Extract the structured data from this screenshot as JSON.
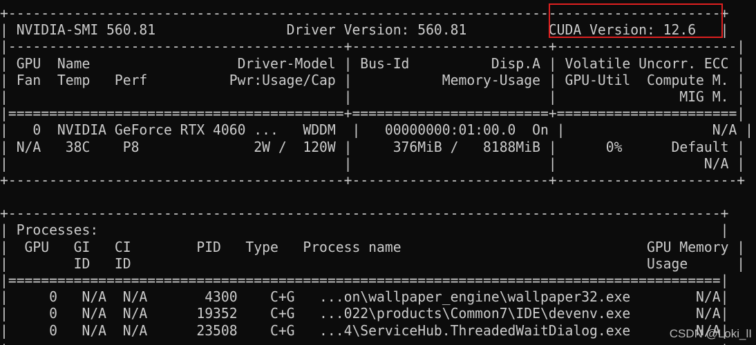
{
  "header": {
    "smi_version": "NVIDIA-SMI 560.81",
    "driver_version": "Driver Version: 560.81",
    "cuda_version": "CUDA Version: 12.6"
  },
  "gpu_table": {
    "header_lines": [
      "| GPU  Name                  Driver-Model | Bus-Id          Disp.A | Volatile Uncorr. ECC |",
      "| Fan  Temp   Perf          Pwr:Usage/Cap |           Memory-Usage | GPU-Util  Compute M. |",
      "|                                         |                        |               MIG M. |"
    ],
    "row_lines": [
      "|   0  NVIDIA GeForce RTX 4060 ...   WDDM  |   00000000:01:00.0  On |                  N/A |",
      "| N/A   38C    P8              2W /  120W |     376MiB /   8188MiB |      0%      Default |",
      "|                                         |                        |                  N/A |"
    ]
  },
  "processes": {
    "title": "Processes:",
    "header_lines": [
      "|  GPU   GI   CI        PID   Type   Process name                              GPU Memory |",
      "|        ID   ID                                                               Usage      |"
    ],
    "rows": [
      {
        "gpu": "0",
        "gi": "N/A",
        "ci": "N/A",
        "pid": "4300",
        "type": "C+G",
        "name": "...on\\wallpaper_engine\\wallpaper32.exe",
        "memory": "N/A"
      },
      {
        "gpu": "0",
        "gi": "N/A",
        "ci": "N/A",
        "pid": "19352",
        "type": "C+G",
        "name": "...022\\products\\Common7\\IDE\\devenv.exe",
        "memory": "N/A"
      },
      {
        "gpu": "0",
        "gi": "N/A",
        "ci": "N/A",
        "pid": "23508",
        "type": "C+G",
        "name": "...4\\ServiceHub.ThreadedWaitDialog.exe",
        "memory": "N/A"
      }
    ]
  },
  "watermark": "CSDN @Loki_lI",
  "colors": {
    "background": "#0c0c0c",
    "text": "#cccccc",
    "highlight": "#e02020"
  }
}
